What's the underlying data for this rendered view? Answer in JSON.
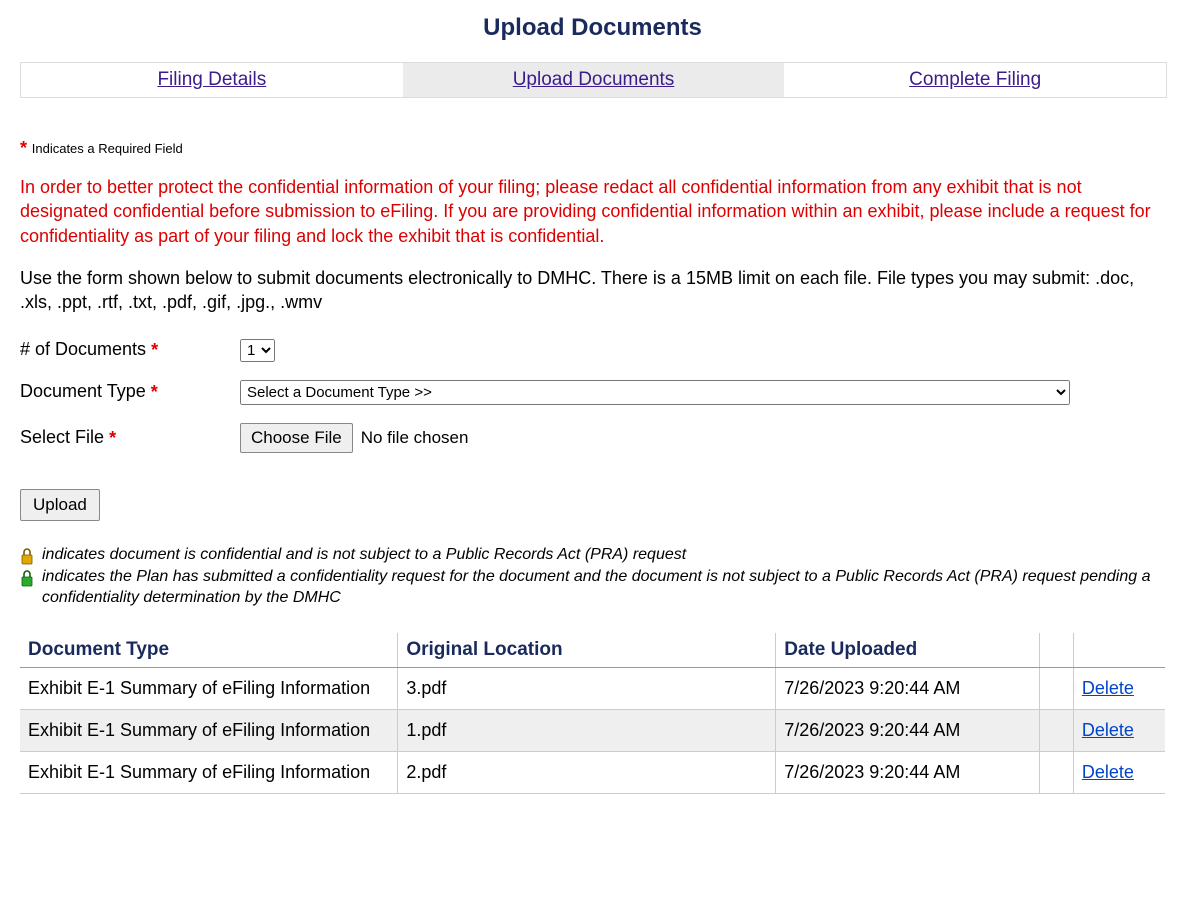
{
  "page_title": "Upload Documents",
  "tabs": {
    "filing_details": "Filing Details",
    "upload_documents": "Upload Documents",
    "complete_filing": "Complete Filing"
  },
  "required_note": "Indicates a Required Field",
  "warning_text": "In order to better protect the confidential information of your filing; please redact all confidential information from any exhibit that is not designated confidential before submission to eFiling. If you are providing confidential information within an exhibit, please include a request for confidentiality as part of your filing and lock the exhibit that is confidential.",
  "instructions_text": "Use the form shown below to submit documents electronically to DMHC. There is a 15MB limit on each file. File types you may submit: .doc, .xls, .ppt, .rtf, .txt, .pdf, .gif, .jpg., .wmv",
  "form": {
    "num_docs_label": "# of Documents",
    "num_docs_value": "1",
    "doc_type_label": "Document Type",
    "doc_type_value": "Select a Document Type >>",
    "select_file_label": "Select File",
    "choose_file_label": "Choose File",
    "file_status": "No file chosen",
    "upload_label": "Upload"
  },
  "legend": {
    "gold": "indicates document is confidential and is not subject to a Public Records Act (PRA) request",
    "green": "indicates the Plan has submitted a confidentiality request for the document and the document is not subject to a Public Records Act (PRA) request pending a confidentiality determination by the DMHC"
  },
  "table": {
    "headers": {
      "type": "Document Type",
      "location": "Original Location",
      "uploaded": "Date Uploaded"
    },
    "rows": [
      {
        "type": "Exhibit E-1 Summary of eFiling Information",
        "location": "3.pdf",
        "uploaded": "7/26/2023 9:20:44 AM",
        "delete": "Delete"
      },
      {
        "type": "Exhibit E-1 Summary of eFiling Information",
        "location": "1.pdf",
        "uploaded": "7/26/2023 9:20:44 AM",
        "delete": "Delete"
      },
      {
        "type": "Exhibit E-1 Summary of eFiling Information",
        "location": "2.pdf",
        "uploaded": "7/26/2023 9:20:44 AM",
        "delete": "Delete"
      }
    ]
  }
}
